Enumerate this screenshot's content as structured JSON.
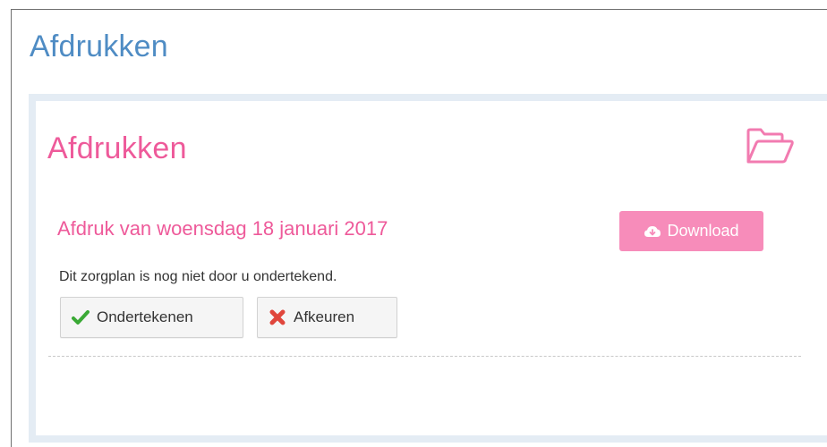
{
  "header": {
    "title": "Afdrukken"
  },
  "panel": {
    "title": "Afdrukken",
    "folder_icon": "folder-open-icon",
    "print": {
      "heading": "Afdruk van woensdag 18 januari 2017",
      "download_label": "Download",
      "download_icon": "cloud-download-icon",
      "status_text": "Dit zorgplan is nog niet door u ondertekend.",
      "sign_label": "Ondertekenen",
      "sign_icon": "checkmark-icon",
      "reject_label": "Afkeuren",
      "reject_icon": "cross-icon"
    }
  },
  "colors": {
    "header_blue": "#4f8cc4",
    "accent_pink": "#ee5a9a",
    "button_pink": "#f78cba",
    "panel_border": "#e4ecf4",
    "check_green": "#3aa935",
    "cross_red": "#e0463c"
  }
}
